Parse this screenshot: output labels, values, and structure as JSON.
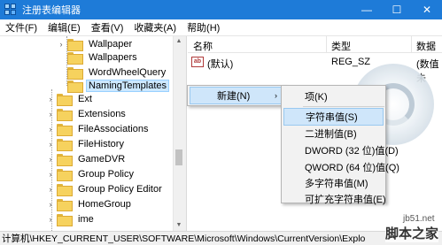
{
  "window": {
    "title": "注册表编辑器",
    "minimize": "—",
    "maximize": "☐",
    "close": "✕"
  },
  "menu": [
    "文件(F)",
    "编辑(E)",
    "查看(V)",
    "收藏夹(A)",
    "帮助(H)"
  ],
  "tree": {
    "items": [
      {
        "label": "Wallpaper"
      },
      {
        "label": "Wallpapers"
      },
      {
        "label": "WordWheelQuery"
      },
      {
        "label": "NamingTemplates",
        "selected": true
      },
      {
        "label": "Ext"
      },
      {
        "label": "Extensions"
      },
      {
        "label": "FileAssociations"
      },
      {
        "label": "FileHistory"
      },
      {
        "label": "GameDVR"
      },
      {
        "label": "Group Policy"
      },
      {
        "label": "Group Policy Editor"
      },
      {
        "label": "HomeGroup"
      },
      {
        "label": "ime"
      }
    ]
  },
  "list": {
    "columns": [
      "名称",
      "类型",
      "数据"
    ],
    "rows": [
      {
        "name": "(默认)",
        "type": "REG_SZ",
        "data": "(数值未"
      }
    ]
  },
  "context_menu": {
    "parent": {
      "label": "新建(N)"
    },
    "submenu": [
      {
        "label": "项(K)"
      },
      {
        "label": "字符串值(S)",
        "highlighted": true
      },
      {
        "label": "二进制值(B)"
      },
      {
        "label": "DWORD (32 位)值(D)"
      },
      {
        "label": "QWORD (64 位)值(Q)"
      },
      {
        "label": "多字符串值(M)"
      },
      {
        "label": "可扩充字符串值(E)"
      }
    ]
  },
  "statusbar": {
    "path": "计算机\\HKEY_CURRENT_USER\\SOFTWARE\\Microsoft\\Windows\\CurrentVersion\\Explo"
  },
  "watermark": {
    "url": "jb51.net",
    "brand": "脚本之家"
  },
  "colors": {
    "titlebar": "#1e7bd8",
    "selection": "#cce8ff",
    "menu_highlight": "#cfe6fa"
  }
}
